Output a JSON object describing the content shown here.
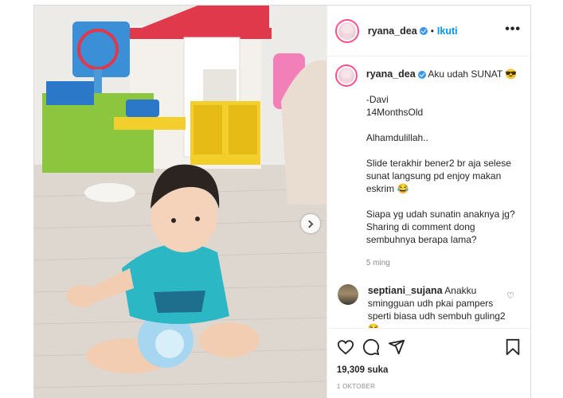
{
  "post": {
    "username": "ryana_dea",
    "follow_label": "Ikuti",
    "more_label": "•••",
    "caption_lines": [
      "-Davi",
      "14MonthsOld",
      "",
      "Alhamdulillah..",
      "",
      "Slide terakhir bener2 br aja selese sunat langsung pd enjoy makan eskrim 😂",
      "",
      "Siapa yg udah sunatin anaknya jg? Sharing di comment dong sembuhnya berapa lama?"
    ],
    "caption_first": "Aku udah SUNAT 😎",
    "time_ago": "5 ming",
    "comment": {
      "username": "septiani_sujana",
      "text": "Anakku smingguan udh pkai pampers sperti biasa udh sembuh guling2 😂"
    },
    "likes": "19,309 suka",
    "date": "1 OKTOBER"
  },
  "colors": {
    "accent": "#0095f6",
    "verified": "#3897f0",
    "story_ring": "#ff4f8b"
  },
  "icons": [
    "verified-badge-icon",
    "more-options-icon",
    "heart-icon",
    "comment-icon",
    "share-icon",
    "bookmark-icon",
    "chevron-right-icon"
  ]
}
